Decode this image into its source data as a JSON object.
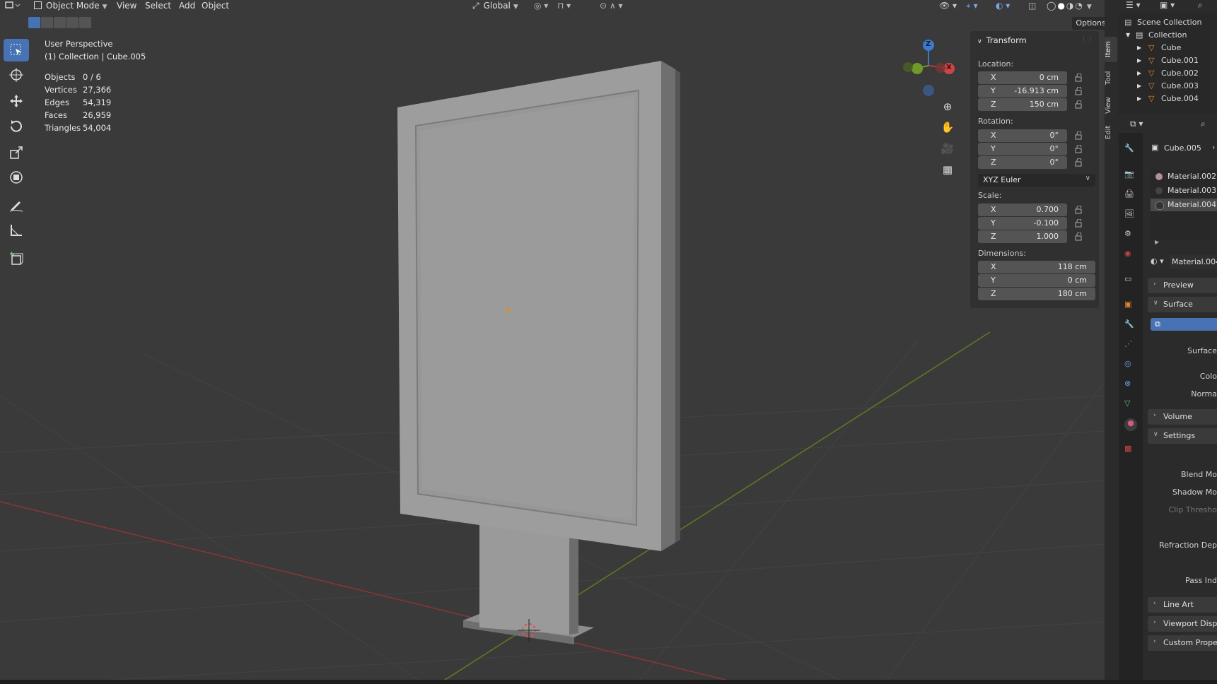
{
  "header": {
    "editor_icon": "3d-viewport-icon",
    "mode": "Object Mode",
    "menus": [
      "View",
      "Select",
      "Add",
      "Object"
    ],
    "orientation": "Global",
    "options_label": "Options"
  },
  "viewport": {
    "perspective": "User Perspective",
    "collection_info": "(1) Collection | Cube.005",
    "stats": [
      {
        "label": "Objects",
        "value": "0 / 6"
      },
      {
        "label": "Vertices",
        "value": "27,366"
      },
      {
        "label": "Edges",
        "value": "54,319"
      },
      {
        "label": "Faces",
        "value": "26,959"
      },
      {
        "label": "Triangles",
        "value": "54,004"
      }
    ],
    "gizmo": {
      "z": "Z",
      "x": "X",
      "y": "Y"
    }
  },
  "toolbar": {
    "tools": [
      "select-box",
      "cursor",
      "move",
      "rotate",
      "scale",
      "transform",
      "annotate",
      "measure",
      "add-cube"
    ]
  },
  "npanel": {
    "title": "Transform",
    "location_label": "Location:",
    "location": [
      {
        "axis": "X",
        "value": "0 cm"
      },
      {
        "axis": "Y",
        "value": "-16.913 cm"
      },
      {
        "axis": "Z",
        "value": "150 cm"
      }
    ],
    "rotation_label": "Rotation:",
    "rotation": [
      {
        "axis": "X",
        "value": "0°"
      },
      {
        "axis": "Y",
        "value": "0°"
      },
      {
        "axis": "Z",
        "value": "0°"
      }
    ],
    "rotation_mode": "XYZ Euler",
    "scale_label": "Scale:",
    "scale": [
      {
        "axis": "X",
        "value": "0.700"
      },
      {
        "axis": "Y",
        "value": "-0.100"
      },
      {
        "axis": "Z",
        "value": "1.000"
      }
    ],
    "dimensions_label": "Dimensions:",
    "dimensions": [
      {
        "axis": "X",
        "value": "118 cm"
      },
      {
        "axis": "Y",
        "value": "0 cm"
      },
      {
        "axis": "Z",
        "value": "180 cm"
      }
    ]
  },
  "vtabs": [
    "Item",
    "Tool",
    "View",
    "Edit"
  ],
  "outliner": {
    "scene_collection": "Scene Collection",
    "collection": "Collection",
    "objects": [
      "Cube",
      "Cube.001",
      "Cube.002",
      "Cube.003",
      "Cube.004"
    ]
  },
  "properties": {
    "object_name": "Cube.005",
    "materials": [
      "Material.002",
      "Material.003",
      "Material.004"
    ],
    "active_material": "Material.004",
    "sections": {
      "preview": "Preview",
      "surface": "Surface",
      "volume": "Volume",
      "settings": "Settings",
      "line_art": "Line Art",
      "viewport_display": "Viewport Displa",
      "custom_properties": "Custom Properti"
    },
    "surface_fields": [
      "Surface",
      "Colo",
      "Norma"
    ],
    "settings_fields": [
      "Blend Mo",
      "Shadow Mo",
      "Clip Thresho",
      "Refraction Dep",
      "Pass Ind"
    ]
  },
  "colors": {
    "accent": "#4772b3",
    "x_axis": "#9a3a3a",
    "y_axis": "#6f9a2a",
    "z_axis": "#3f79c9"
  }
}
